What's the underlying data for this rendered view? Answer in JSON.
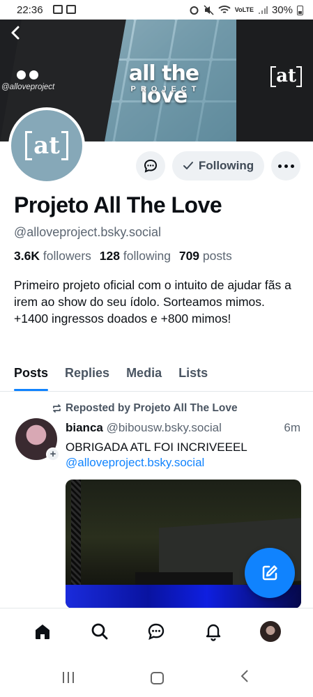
{
  "status_bar": {
    "time": "22:36",
    "battery": "30%",
    "network": "VoLTE"
  },
  "banner": {
    "title": "all the love",
    "subtitle": "PROJECT",
    "handle": "@alloveproject",
    "logo_text": "at"
  },
  "avatar": {
    "logo_text": "at"
  },
  "actions": {
    "following_label": "Following"
  },
  "profile": {
    "display_name": "Projeto All The Love",
    "handle": "@alloveproject.bsky.social",
    "followers_count": "3.6K",
    "followers_label": "followers",
    "following_count": "128",
    "following_label": "following",
    "posts_count": "709",
    "posts_label": "posts",
    "bio": "Primeiro projeto oficial com o intuito de ajudar fãs a irem ao show do seu ídolo. Sorteamos mimos. +1400 ingressos doados e +800 mimos!"
  },
  "tabs": [
    {
      "label": "Posts",
      "active": true
    },
    {
      "label": "Replies",
      "active": false
    },
    {
      "label": "Media",
      "active": false
    },
    {
      "label": "Lists",
      "active": false
    }
  ],
  "post": {
    "repost_label": "Reposted by Projeto All The Love",
    "author_name": "bianca",
    "author_handle": "@bibousw.bsky.social",
    "time": "6m",
    "text": "OBRIGADA ATL FOI INCRIVEEEL",
    "mention": "@alloveproject.bsky.social"
  },
  "colors": {
    "accent": "#1083fe",
    "muted": "#5b6571",
    "button_bg": "#eef1f4"
  },
  "icons": {
    "back": "chevron-left-icon",
    "message": "chat-bubble-icon",
    "check": "check-icon",
    "more": "ellipsis-icon",
    "repost": "repost-icon",
    "compose": "compose-icon",
    "home": "home-icon",
    "search": "search-icon",
    "chat": "chat-icon",
    "notifications": "bell-icon"
  }
}
